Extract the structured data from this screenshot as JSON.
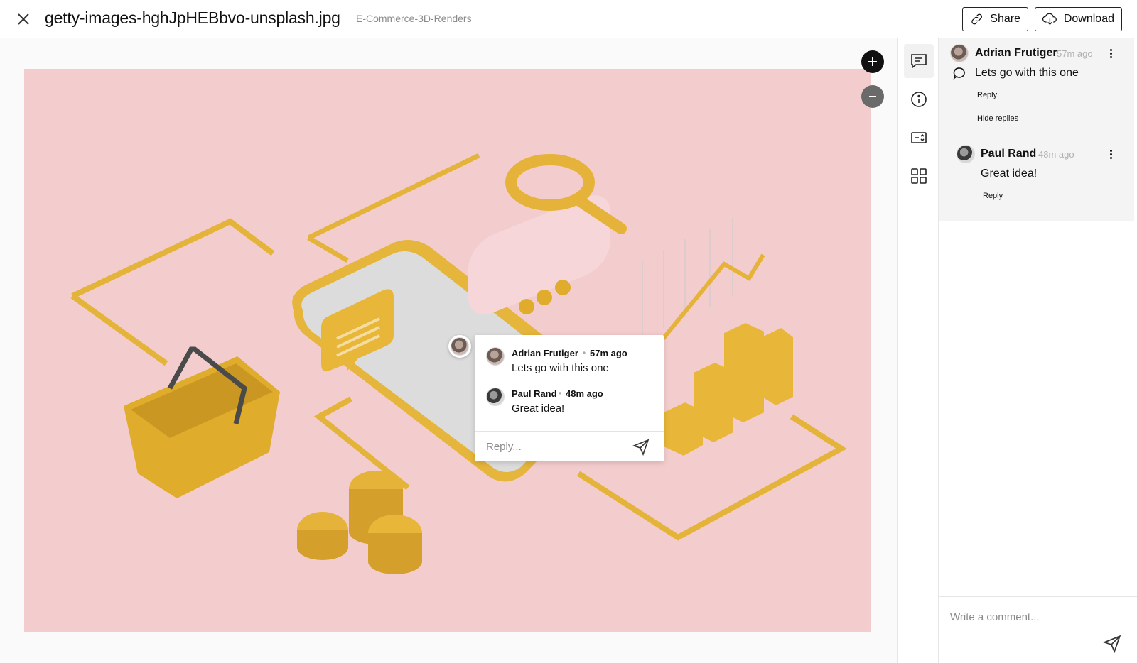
{
  "header": {
    "file_name": "getty-images-hghJpHEBbvo-unsplash.jpg",
    "folder": "E-Commerce-3D-Renders",
    "share_label": "Share",
    "download_label": "Download"
  },
  "icons": {
    "close": "close-icon",
    "share": "link-icon",
    "download": "cloud-download-icon",
    "zoom_in": "plus-icon",
    "zoom_out": "minus-icon",
    "rail": [
      "comments-icon",
      "info-icon",
      "compare-icon",
      "grid-icon"
    ],
    "send": "send-icon"
  },
  "colors": {
    "image_bg": "#f3cdcd",
    "accent_yellow": "#e8b73a",
    "thread_bg": "#f4f4f4"
  },
  "thread": {
    "comment": {
      "author": "Adrian Frutiger",
      "time": "57m ago",
      "text": "Lets go with this one",
      "reply_label": "Reply",
      "hide_replies_label": "Hide replies"
    },
    "reply": {
      "author": "Paul Rand",
      "time": "48m ago",
      "text": "Great idea!",
      "reply_label": "Reply"
    }
  },
  "composer": {
    "placeholder": "Write a comment..."
  },
  "popover": {
    "comments": [
      {
        "author": "Adrian Frutiger",
        "time": "57m ago",
        "text": "Lets go with this one"
      },
      {
        "author": "Paul Rand",
        "time": "48m ago",
        "text": "Great idea!"
      }
    ],
    "reply_placeholder": "Reply..."
  }
}
